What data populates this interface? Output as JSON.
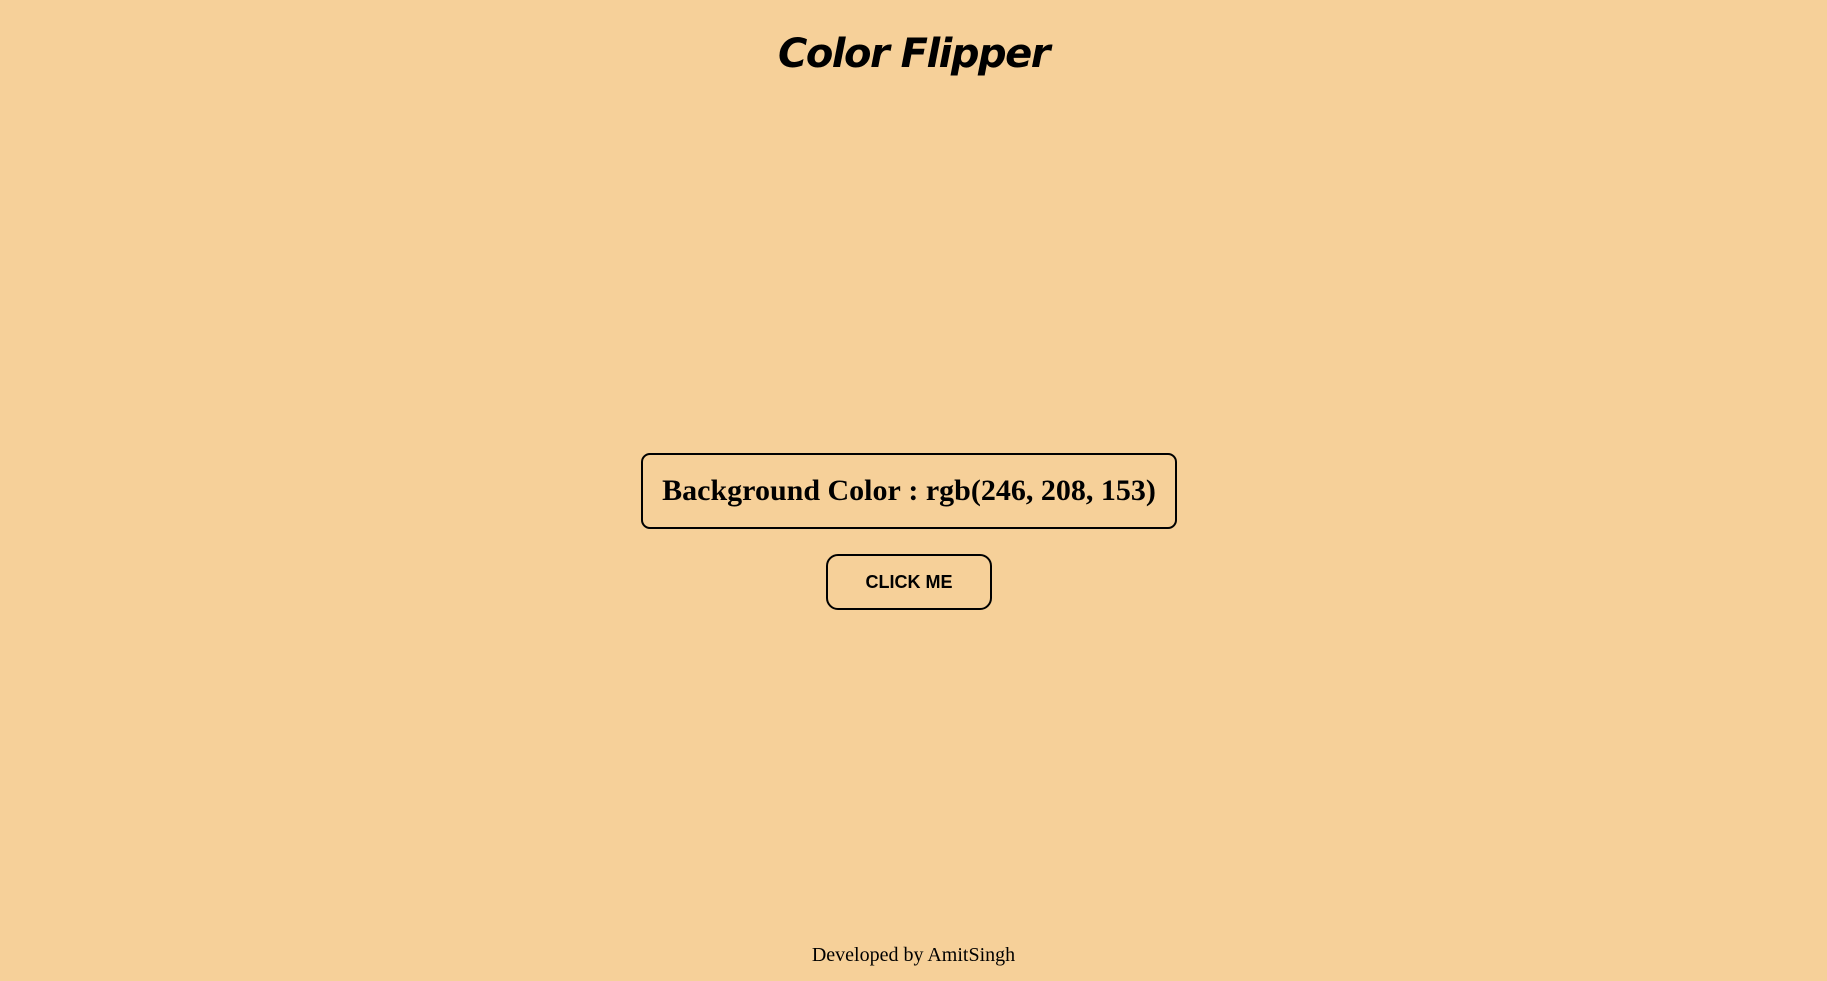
{
  "header": {
    "title": "Color Flipper"
  },
  "color_display": {
    "label": "Background Color",
    "separator": " : ",
    "value": "rgb(246, 208, 153)"
  },
  "actions": {
    "click_label": "CLICK ME"
  },
  "footer": {
    "text": "Developed by AmitSingh"
  },
  "colors": {
    "background": "#f6d099",
    "text": "#000000",
    "border": "#000000"
  }
}
